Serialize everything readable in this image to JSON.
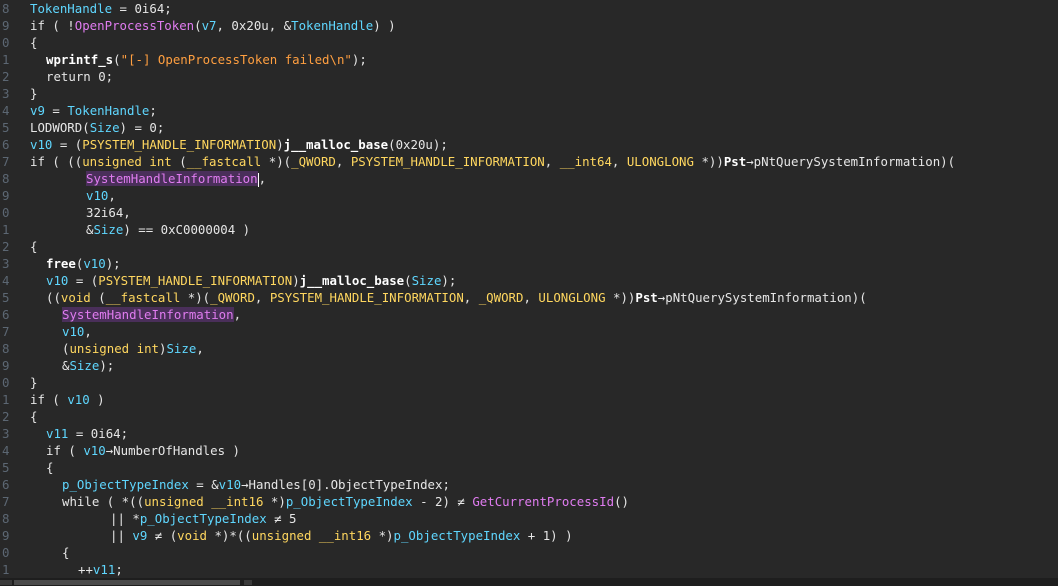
{
  "editor": {
    "lines": [
      {
        "num": "8",
        "indent": 0,
        "tokens": [
          [
            "var",
            "TokenHandle"
          ],
          [
            "default",
            " = 0i64;"
          ]
        ]
      },
      {
        "num": "9",
        "indent": 0,
        "tokens": [
          [
            "default",
            "if ( !"
          ],
          [
            "func",
            "OpenProcessToken"
          ],
          [
            "default",
            "("
          ],
          [
            "var",
            "v7"
          ],
          [
            "default",
            ", 0x20u, &"
          ],
          [
            "var",
            "TokenHandle"
          ],
          [
            "default",
            ") )"
          ]
        ]
      },
      {
        "num": "0",
        "indent": 0,
        "tokens": [
          [
            "default",
            "{"
          ]
        ]
      },
      {
        "num": "1",
        "indent": 2,
        "tokens": [
          [
            "bold",
            "wprintf_s"
          ],
          [
            "default",
            "("
          ],
          [
            "str",
            "\"[-] OpenProcessToken failed\\n\""
          ],
          [
            "default",
            ");"
          ]
        ]
      },
      {
        "num": "2",
        "indent": 2,
        "tokens": [
          [
            "default",
            "return 0;"
          ]
        ]
      },
      {
        "num": "3",
        "indent": 0,
        "tokens": [
          [
            "default",
            "}"
          ]
        ]
      },
      {
        "num": "4",
        "indent": 0,
        "tokens": [
          [
            "var",
            "v9"
          ],
          [
            "default",
            " = "
          ],
          [
            "var",
            "TokenHandle"
          ],
          [
            "default",
            ";"
          ]
        ]
      },
      {
        "num": "5",
        "indent": 0,
        "tokens": [
          [
            "default",
            "LODWORD("
          ],
          [
            "var",
            "Size"
          ],
          [
            "default",
            ") = 0;"
          ]
        ]
      },
      {
        "num": "6",
        "indent": 0,
        "tokens": [
          [
            "var",
            "v10"
          ],
          [
            "default",
            " = ("
          ],
          [
            "type",
            "PSYSTEM_HANDLE_INFORMATION"
          ],
          [
            "default",
            ")"
          ],
          [
            "bold",
            "j__malloc_base"
          ],
          [
            "default",
            "(0x20u);"
          ]
        ]
      },
      {
        "num": "7",
        "indent": 0,
        "tokens": [
          [
            "default",
            "if ( (("
          ],
          [
            "type",
            "unsigned int"
          ],
          [
            "default",
            " ("
          ],
          [
            "type",
            "__fastcall"
          ],
          [
            "default",
            " *)("
          ],
          [
            "type",
            "_QWORD"
          ],
          [
            "default",
            ", "
          ],
          [
            "type",
            "PSYSTEM_HANDLE_INFORMATION"
          ],
          [
            "default",
            ", "
          ],
          [
            "type",
            "__int64"
          ],
          [
            "default",
            ", "
          ],
          [
            "type",
            "ULONGLONG"
          ],
          [
            "default",
            " *))"
          ],
          [
            "bold",
            "Pst"
          ],
          [
            "default",
            "→pNtQuerySystemInformation)("
          ]
        ]
      },
      {
        "num": "8",
        "indent": 7,
        "tokens": [
          [
            "hl",
            "SystemHandleInformation"
          ],
          [
            "cursor",
            ""
          ],
          [
            "default",
            ","
          ]
        ]
      },
      {
        "num": "9",
        "indent": 7,
        "tokens": [
          [
            "var",
            "v10"
          ],
          [
            "default",
            ","
          ]
        ]
      },
      {
        "num": "0",
        "indent": 7,
        "tokens": [
          [
            "default",
            "32i64,"
          ]
        ]
      },
      {
        "num": "1",
        "indent": 7,
        "tokens": [
          [
            "default",
            "&"
          ],
          [
            "var",
            "Size"
          ],
          [
            "default",
            ") == 0xC0000004 )"
          ]
        ]
      },
      {
        "num": "2",
        "indent": 0,
        "tokens": [
          [
            "default",
            "{"
          ]
        ]
      },
      {
        "num": "3",
        "indent": 2,
        "tokens": [
          [
            "bold",
            "free"
          ],
          [
            "default",
            "("
          ],
          [
            "var",
            "v10"
          ],
          [
            "default",
            ");"
          ]
        ]
      },
      {
        "num": "4",
        "indent": 2,
        "tokens": [
          [
            "var",
            "v10"
          ],
          [
            "default",
            " = ("
          ],
          [
            "type",
            "PSYSTEM_HANDLE_INFORMATION"
          ],
          [
            "default",
            ")"
          ],
          [
            "bold",
            "j__malloc_base"
          ],
          [
            "default",
            "("
          ],
          [
            "var",
            "Size"
          ],
          [
            "default",
            ");"
          ]
        ]
      },
      {
        "num": "5",
        "indent": 2,
        "tokens": [
          [
            "default",
            "(("
          ],
          [
            "type",
            "void"
          ],
          [
            "default",
            " ("
          ],
          [
            "type",
            "__fastcall"
          ],
          [
            "default",
            " *)("
          ],
          [
            "type",
            "_QWORD"
          ],
          [
            "default",
            ", "
          ],
          [
            "type",
            "PSYSTEM_HANDLE_INFORMATION"
          ],
          [
            "default",
            ", "
          ],
          [
            "type",
            "_QWORD"
          ],
          [
            "default",
            ", "
          ],
          [
            "type",
            "ULONGLONG"
          ],
          [
            "default",
            " *))"
          ],
          [
            "bold",
            "Pst"
          ],
          [
            "default",
            "→pNtQuerySystemInformation)("
          ]
        ]
      },
      {
        "num": "6",
        "indent": 4,
        "tokens": [
          [
            "hl",
            "SystemHandleInformation"
          ],
          [
            "default",
            ","
          ]
        ]
      },
      {
        "num": "7",
        "indent": 4,
        "tokens": [
          [
            "var",
            "v10"
          ],
          [
            "default",
            ","
          ]
        ]
      },
      {
        "num": "8",
        "indent": 4,
        "tokens": [
          [
            "default",
            "("
          ],
          [
            "type",
            "unsigned int"
          ],
          [
            "default",
            ")"
          ],
          [
            "var",
            "Size"
          ],
          [
            "default",
            ","
          ]
        ]
      },
      {
        "num": "9",
        "indent": 4,
        "tokens": [
          [
            "default",
            "&"
          ],
          [
            "var",
            "Size"
          ],
          [
            "default",
            ");"
          ]
        ]
      },
      {
        "num": "0",
        "indent": 0,
        "tokens": [
          [
            "default",
            "}"
          ]
        ]
      },
      {
        "num": "1",
        "indent": 0,
        "tokens": [
          [
            "default",
            "if ( "
          ],
          [
            "var",
            "v10"
          ],
          [
            "default",
            " )"
          ]
        ]
      },
      {
        "num": "2",
        "indent": 0,
        "tokens": [
          [
            "default",
            "{"
          ]
        ]
      },
      {
        "num": "3",
        "indent": 2,
        "tokens": [
          [
            "var",
            "v11"
          ],
          [
            "default",
            " = 0i64;"
          ]
        ]
      },
      {
        "num": "4",
        "indent": 2,
        "tokens": [
          [
            "default",
            "if ( "
          ],
          [
            "var",
            "v10"
          ],
          [
            "default",
            "→NumberOfHandles )"
          ]
        ]
      },
      {
        "num": "5",
        "indent": 2,
        "tokens": [
          [
            "default",
            "{"
          ]
        ]
      },
      {
        "num": "6",
        "indent": 4,
        "tokens": [
          [
            "var",
            "p_ObjectTypeIndex"
          ],
          [
            "default",
            " = &"
          ],
          [
            "var",
            "v10"
          ],
          [
            "default",
            "→Handles[0].ObjectTypeIndex;"
          ]
        ]
      },
      {
        "num": "7",
        "indent": 4,
        "tokens": [
          [
            "default",
            "while ( *(("
          ],
          [
            "type",
            "unsigned __int16"
          ],
          [
            "default",
            " *)"
          ],
          [
            "var",
            "p_ObjectTypeIndex"
          ],
          [
            "default",
            " - 2) ≠ "
          ],
          [
            "func",
            "GetCurrentProcessId"
          ],
          [
            "default",
            "()"
          ]
        ]
      },
      {
        "num": "8",
        "indent": 10,
        "tokens": [
          [
            "default",
            "|| *"
          ],
          [
            "var",
            "p_ObjectTypeIndex"
          ],
          [
            "default",
            " ≠ 5"
          ]
        ]
      },
      {
        "num": "9",
        "indent": 10,
        "tokens": [
          [
            "default",
            "|| "
          ],
          [
            "var",
            "v9"
          ],
          [
            "default",
            " ≠ ("
          ],
          [
            "type",
            "void"
          ],
          [
            "default",
            " *)*(("
          ],
          [
            "type",
            "unsigned __int16"
          ],
          [
            "default",
            " *)"
          ],
          [
            "var",
            "p_ObjectTypeIndex"
          ],
          [
            "default",
            " + 1) )"
          ]
        ]
      },
      {
        "num": "0",
        "indent": 4,
        "tokens": [
          [
            "default",
            "{"
          ]
        ]
      },
      {
        "num": "1",
        "indent": 6,
        "tokens": [
          [
            "default",
            "++"
          ],
          [
            "var",
            "v11"
          ],
          [
            "default",
            ";"
          ]
        ]
      }
    ]
  }
}
